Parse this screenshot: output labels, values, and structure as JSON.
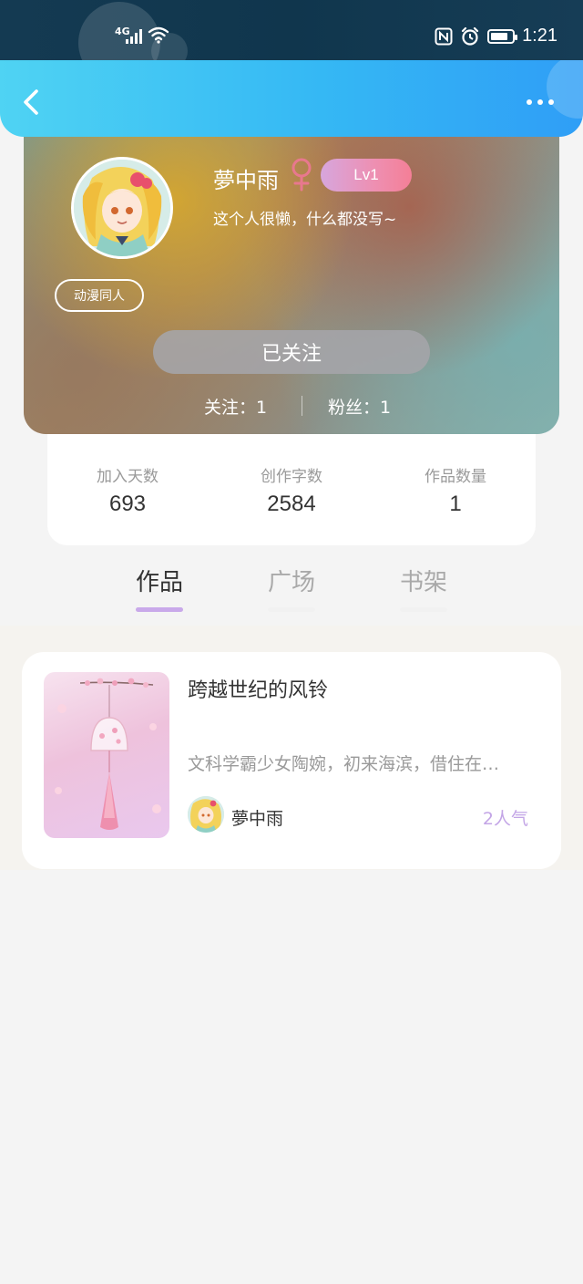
{
  "status_bar": {
    "network": "4G",
    "time": "1:21"
  },
  "header": {
    "back_icon": "chevron-left-icon",
    "more_icon": "more-dots-icon"
  },
  "profile": {
    "username": "夢中雨",
    "gender_icon": "female-icon",
    "gender_color": "#e8788e",
    "level": "Lv1",
    "bio": "这个人很懒，什么都没写~",
    "tag": "动漫同人",
    "follow_button": "已关注",
    "following": "关注：1",
    "fans": "粉丝：1"
  },
  "stats": [
    {
      "label": "加入天数",
      "value": "693"
    },
    {
      "label": "创作字数",
      "value": "2584"
    },
    {
      "label": "作品数量",
      "value": "1"
    }
  ],
  "tabs": [
    {
      "label": "作品",
      "active": true
    },
    {
      "label": "广场",
      "active": false
    },
    {
      "label": "书架",
      "active": false
    }
  ],
  "works": [
    {
      "title": "跨越世纪的风铃",
      "description": "文科学霸少女陶婉，初来海滨，借住在…",
      "author": "夢中雨",
      "popularity": "2人气"
    }
  ],
  "colors": {
    "header_start": "#4fd3f3",
    "header_end": "#2f9ef6",
    "tab_active_underline": "#c9a9ea",
    "popularity": "#c3a5e6"
  }
}
